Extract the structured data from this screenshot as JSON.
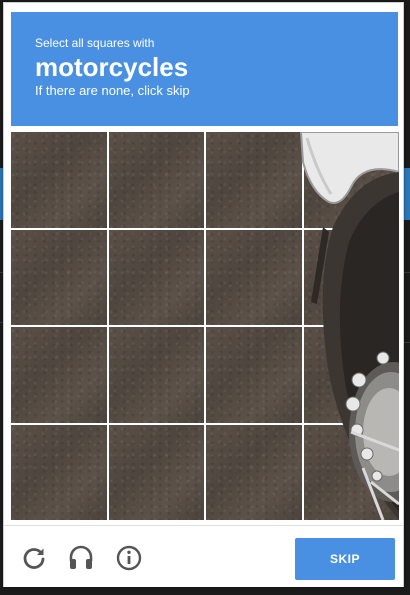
{
  "header": {
    "instruction": "Select all squares with",
    "target": "motorcycles",
    "subtext": "If there are none, click skip"
  },
  "grid": {
    "rows": 4,
    "columns": 4,
    "image_subject": "motorcycle on asphalt"
  },
  "footer": {
    "icons": [
      "reload-icon",
      "headphones-icon",
      "info-icon"
    ],
    "skip_label": "SKIP"
  },
  "colors": {
    "accent": "#4a90e2",
    "asphalt": "#574d45",
    "backdrop": "#1b1b1b"
  }
}
